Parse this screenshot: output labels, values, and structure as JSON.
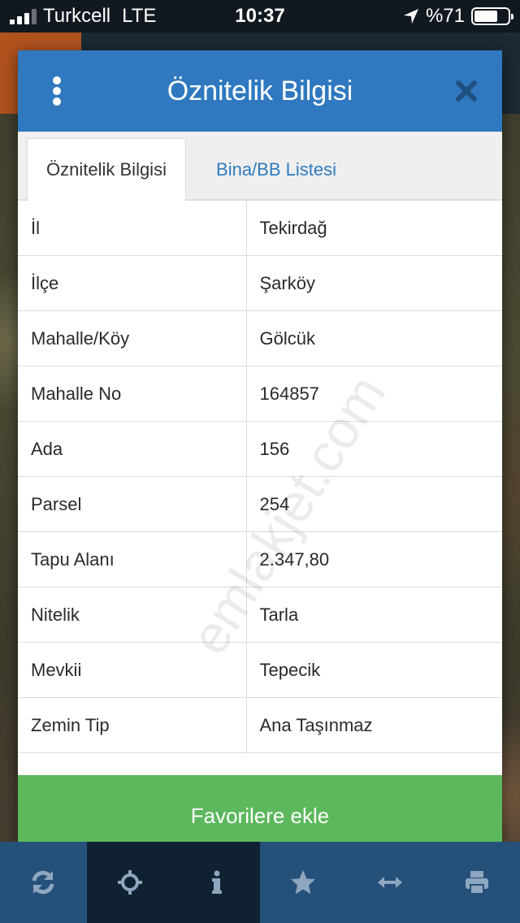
{
  "status_bar": {
    "carrier": "Turkcell",
    "network": "LTE",
    "time": "10:37",
    "battery": "%71",
    "battery_level": 0.71
  },
  "modal": {
    "title": "Öznitelik Bilgisi",
    "icons": {
      "menu": "vertical-dots-icon",
      "close": "close-icon"
    },
    "tabs": [
      {
        "label": "Öznitelik Bilgisi",
        "active": true
      },
      {
        "label": "Bina/BB Listesi",
        "active": false
      }
    ],
    "rows": [
      {
        "key": "İl",
        "value": "Tekirdağ"
      },
      {
        "key": "İlçe",
        "value": "Şarköy"
      },
      {
        "key": "Mahalle/Köy",
        "value": "Gölcük"
      },
      {
        "key": "Mahalle No",
        "value": "164857"
      },
      {
        "key": "Ada",
        "value": "156"
      },
      {
        "key": "Parsel",
        "value": "254"
      },
      {
        "key": "Tapu Alanı",
        "value": "2.347,80"
      },
      {
        "key": "Nitelik",
        "value": "Tarla"
      },
      {
        "key": "Mevkii",
        "value": "Tepecik"
      },
      {
        "key": "Zemin Tip",
        "value": "Ana Taşınmaz"
      }
    ],
    "favorite_button": "Favorilere ekle",
    "watermark": "emlakjet.com"
  },
  "toolbar": {
    "items": [
      "refresh-icon",
      "crosshair-icon",
      "info-icon",
      "star-icon",
      "measure-arrows-icon",
      "print-icon"
    ]
  },
  "colors": {
    "header": "#3079c0",
    "tab_link": "#2e7bbf",
    "favorite": "#5cb85c",
    "toolbar": "#25507a",
    "toolbar_active": "#102232"
  }
}
